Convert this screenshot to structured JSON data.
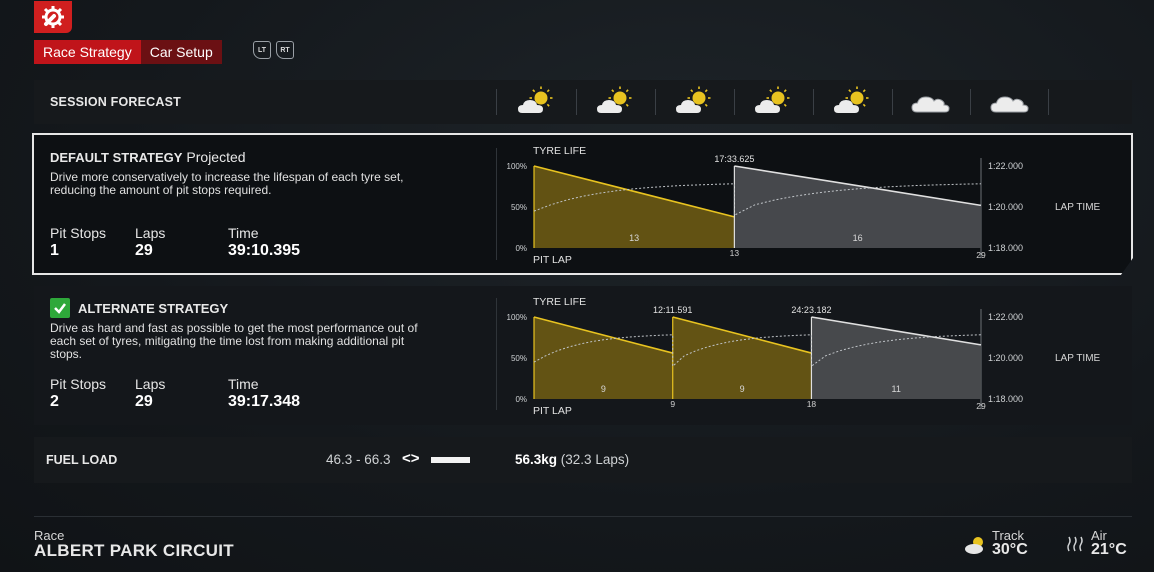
{
  "header": {
    "tabs": [
      "Race Strategy",
      "Car Setup"
    ],
    "bumper_left": "LT",
    "bumper_right": "RT"
  },
  "forecast": {
    "title": "SESSION FORECAST",
    "icons": [
      "partly-sunny-icon",
      "partly-sunny-icon",
      "partly-sunny-icon",
      "partly-sunny-icon",
      "partly-sunny-icon",
      "cloud-icon",
      "cloud-icon"
    ]
  },
  "default_strategy": {
    "title": "DEFAULT STRATEGY",
    "subtitle": "Projected",
    "description_line1": "Drive more conservatively to increase the lifespan of each tyre set,",
    "description_line2": "reducing the amount of pit stops required.",
    "pit_stops_label": "Pit Stops",
    "pit_stops": "1",
    "laps_label": "Laps",
    "laps": "29",
    "time_label": "Time",
    "time": "39:10.395"
  },
  "alternate_strategy": {
    "title": "ALTERNATE STRATEGY",
    "description_line1": "Drive as hard and fast as possible to get the most performance out of",
    "description_line2": "each set of tyres, mitigating the time lost from making additional pit",
    "description_line3": "stops.",
    "pit_stops_label": "Pit Stops",
    "pit_stops": "2",
    "laps_label": "Laps",
    "laps": "29",
    "time_label": "Time",
    "time": "39:17.348",
    "selected": true
  },
  "chart_data": [
    {
      "type": "area",
      "title": "TYRE LIFE",
      "xlabel": "PIT LAP",
      "ylabel_right": "LAP TIME",
      "y_ticks_left": [
        "100%",
        "50%",
        "0%"
      ],
      "y_ticks_right": [
        "1:22.000",
        "1:20.000",
        "1:18.000"
      ],
      "x_range": [
        0,
        29
      ],
      "stints": [
        {
          "start": 0,
          "end": 13,
          "laps_label": "13",
          "compound": "medium",
          "color": "#e8c320",
          "life_start": 100,
          "life_end": 38
        },
        {
          "start": 13,
          "end": 29,
          "laps_label": "16",
          "compound": "hard",
          "color": "#e0e0e0",
          "life_start": 100,
          "life_end": 52
        }
      ],
      "pit_markers": [
        {
          "lap": "13",
          "time": "17:33.625"
        }
      ],
      "x_end_label": "29"
    },
    {
      "type": "area",
      "title": "TYRE LIFE",
      "xlabel": "PIT LAP",
      "ylabel_right": "LAP TIME",
      "y_ticks_left": [
        "100%",
        "50%",
        "0%"
      ],
      "y_ticks_right": [
        "1:22.000",
        "1:20.000",
        "1:18.000"
      ],
      "x_range": [
        0,
        29
      ],
      "stints": [
        {
          "start": 0,
          "end": 9,
          "laps_label": "9",
          "compound": "medium",
          "color": "#e8c320",
          "life_start": 100,
          "life_end": 56
        },
        {
          "start": 9,
          "end": 18,
          "laps_label": "9",
          "compound": "medium",
          "color": "#e8c320",
          "life_start": 100,
          "life_end": 56
        },
        {
          "start": 18,
          "end": 29,
          "laps_label": "11",
          "compound": "hard",
          "color": "#e0e0e0",
          "life_start": 100,
          "life_end": 66
        }
      ],
      "pit_markers": [
        {
          "lap": "9",
          "time": "12:11.591"
        },
        {
          "lap": "18",
          "time": "24:23.182"
        }
      ],
      "x_end_label": "29"
    }
  ],
  "fuel": {
    "label": "FUEL LOAD",
    "range": "46.3 - 66.3",
    "arrows": "<>",
    "value": "56.3kg",
    "laps": "(32.3 Laps)"
  },
  "footer": {
    "session": "Race",
    "circuit": "ALBERT PARK CIRCUIT",
    "track_label": "Track",
    "track_temp": "30°C",
    "air_label": "Air",
    "air_temp": "21°C"
  }
}
